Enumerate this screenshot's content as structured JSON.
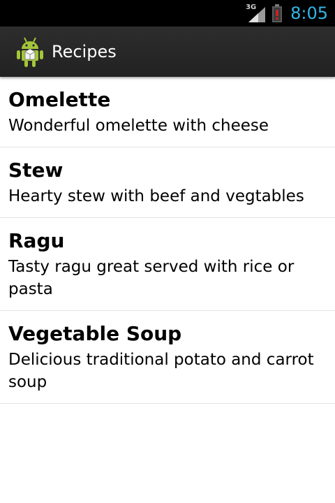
{
  "status_bar": {
    "network": "3G",
    "time": "8:05",
    "icons": [
      "signal-icon",
      "battery-alert-icon"
    ],
    "clock_color": "#33b5e5"
  },
  "action_bar": {
    "title": "Recipes",
    "icon": "android-app-icon",
    "icon_color": "#a4c639"
  },
  "recipes": [
    {
      "name": "Omelette",
      "description": "Wonderful omelette with cheese"
    },
    {
      "name": "Stew",
      "description": "Hearty stew with beef and vegtables"
    },
    {
      "name": "Ragu",
      "description": "Tasty ragu great served with rice or pasta"
    },
    {
      "name": "Vegetable Soup",
      "description": "Delicious traditional potato and carrot soup"
    }
  ]
}
